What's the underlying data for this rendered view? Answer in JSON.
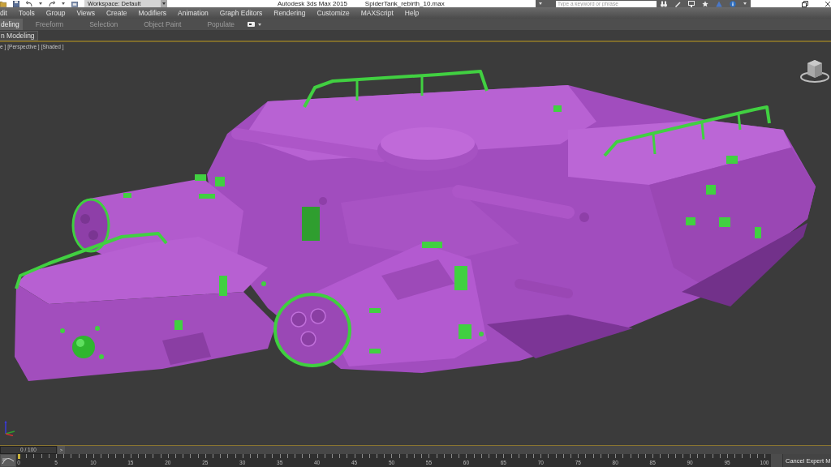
{
  "title_bar": {
    "workspace": "Workspace: Default",
    "title": "Autodesk 3ds Max 2015",
    "file_name": "SpiderTank_rebirth_10.max",
    "search": {
      "placeholder": "Type a keyword or phrase"
    }
  },
  "menu_bar": [
    "dit",
    "Tools",
    "Group",
    "Views",
    "Create",
    "Modifiers",
    "Animation",
    "Graph Editors",
    "Rendering",
    "Customize",
    "MAXScript",
    "Help"
  ],
  "ribbon_tabs": [
    {
      "label": "deling",
      "selected": true
    },
    {
      "label": "Freeform",
      "selected": false
    },
    {
      "label": "Selection",
      "selected": false
    },
    {
      "label": "Object Paint",
      "selected": false
    },
    {
      "label": "Populate",
      "selected": false
    }
  ],
  "ribbon_panel": {
    "title": "n Modeling"
  },
  "viewport": {
    "menus": [
      "e ]",
      "[Perspective ]",
      "[Shaded ]"
    ]
  },
  "time_slider": {
    "counter": "0 / 100",
    "level": 0,
    "next_button": ">"
  },
  "timeline": {
    "ticks": [
      "0",
      "5",
      "10",
      "15",
      "20",
      "25",
      "30",
      "35",
      "40",
      "45",
      "50",
      "55",
      "60",
      "65",
      "70",
      "75",
      "80",
      "85",
      "90",
      "95",
      "100"
    ]
  },
  "status_bar": {
    "button": "Cancel Expert M"
  }
}
